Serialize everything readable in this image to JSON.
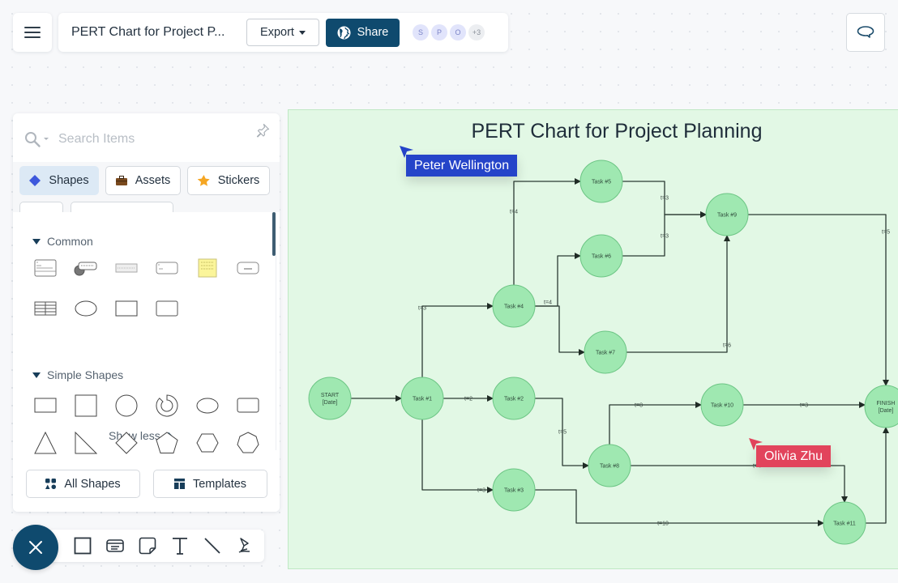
{
  "header": {
    "doc_title": "PERT Chart for Project P...",
    "export_label": "Export",
    "share_label": "Share",
    "collaborators": [
      "S",
      "P",
      "O"
    ],
    "more_collaborators": "+3"
  },
  "panel": {
    "search_placeholder": "Search Items",
    "tabs": [
      {
        "label": "Shapes",
        "icon": "diamond-icon",
        "active": true
      },
      {
        "label": "Assets",
        "icon": "briefcase-icon",
        "active": false
      },
      {
        "label": "Stickers",
        "icon": "star-icon",
        "active": false
      }
    ],
    "sections": [
      {
        "title": "Common",
        "items": [
          "class-shape",
          "callout-shape",
          "ui-bar-shape",
          "note-card-shape",
          "sticky-note-shape",
          "button-shape",
          "table-shape",
          "ellipse-shape",
          "rectangle-shape",
          "rounded-rectangle-shape"
        ]
      },
      {
        "title": "Simple Shapes",
        "items": [
          "rectangle",
          "square",
          "circle",
          "donut",
          "ellipse",
          "rounded-rectangle",
          "triangle",
          "right-triangle",
          "diamond",
          "pentagon",
          "hexagon",
          "heptagon"
        ]
      }
    ],
    "show_less_label": "Show less",
    "all_shapes_label": "All Shapes",
    "templates_label": "Templates"
  },
  "toolbar": {
    "tools": [
      "rectangle-tool",
      "text-card-tool",
      "sticky-note-tool",
      "text-tool",
      "line-tool",
      "pen-tool"
    ]
  },
  "diagram": {
    "title": "PERT Chart for Project Planning",
    "colors": {
      "node_fill": "#9fe8b1",
      "node_stroke": "#6cc584",
      "edge": "#2b3a33",
      "background": "#e2f8e5"
    },
    "nodes": [
      {
        "id": "start",
        "lines": [
          "START",
          "[Date]"
        ]
      },
      {
        "id": "t1",
        "lines": [
          "Task #1"
        ]
      },
      {
        "id": "t2",
        "lines": [
          "Task #2"
        ]
      },
      {
        "id": "t3",
        "lines": [
          "Task #3"
        ]
      },
      {
        "id": "t4",
        "lines": [
          "Task #4"
        ]
      },
      {
        "id": "t5",
        "lines": [
          "Task #5"
        ]
      },
      {
        "id": "t6",
        "lines": [
          "Task #6"
        ]
      },
      {
        "id": "t7",
        "lines": [
          "Task #7"
        ]
      },
      {
        "id": "t8",
        "lines": [
          "Task #8"
        ]
      },
      {
        "id": "t9",
        "lines": [
          "Task #9"
        ]
      },
      {
        "id": "t10",
        "lines": [
          "Task #10"
        ]
      },
      {
        "id": "t11",
        "lines": [
          "Task #11"
        ]
      },
      {
        "id": "finish",
        "lines": [
          "FINISH",
          "[Date]"
        ]
      }
    ],
    "edges": [
      {
        "from": "start",
        "to": "t1",
        "label": ""
      },
      {
        "from": "t1",
        "to": "t4",
        "label": "t=3"
      },
      {
        "from": "t1",
        "to": "t2",
        "label": "t=2"
      },
      {
        "from": "t1",
        "to": "t3",
        "label": "t=3"
      },
      {
        "from": "t4",
        "to": "t5",
        "label": "t=4"
      },
      {
        "from": "t4",
        "to": "t6",
        "label": "t=4"
      },
      {
        "from": "t4",
        "to": "t7",
        "label": ""
      },
      {
        "from": "t5",
        "to": "t9",
        "label": "t=3"
      },
      {
        "from": "t6",
        "to": "t9",
        "label": "t=3"
      },
      {
        "from": "t7",
        "to": "t9",
        "label": "t=6"
      },
      {
        "from": "t9",
        "to": "finish",
        "label": "t=5"
      },
      {
        "from": "t2",
        "to": "t8",
        "label": "t=5"
      },
      {
        "from": "t8",
        "to": "t10",
        "label": "t=8"
      },
      {
        "from": "t8",
        "to": "t11",
        "label": "t=4"
      },
      {
        "from": "t10",
        "to": "finish",
        "label": "t=3"
      },
      {
        "from": "t3",
        "to": "t11",
        "label": "t=10"
      },
      {
        "from": "t11",
        "to": "finish",
        "label": ""
      }
    ]
  },
  "cursors": [
    {
      "name": "Peter Wellington",
      "color": "#2544c9"
    },
    {
      "name": "Olivia Zhu",
      "color": "#e2445c"
    }
  ]
}
